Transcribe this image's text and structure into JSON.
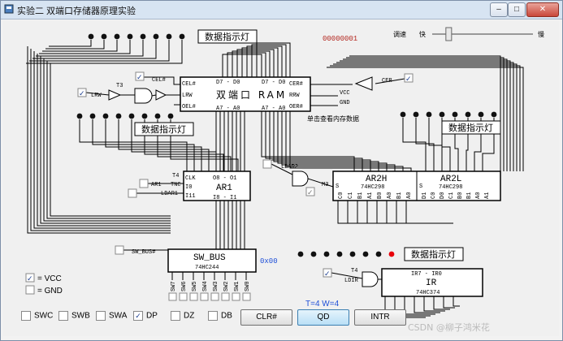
{
  "window": {
    "title": "实验二 双端口存储器原理实验",
    "controls": {
      "minimize": "–",
      "maximize": "□",
      "close": "✕"
    }
  },
  "ram": {
    "name": "双端口 RAM",
    "left_pins": [
      "CEL#",
      "LRW",
      "OEL#"
    ],
    "right_pins": [
      "CER#",
      "RRW",
      "OER#"
    ],
    "top_left": "D7 - D0",
    "top_right": "D7 - D0",
    "bottom_left": "A7 - A0",
    "bottom_right": "A7 - A0",
    "hint": "单击查看内存数据",
    "vcc": "VCC",
    "gnd": "GND"
  },
  "data_indicator_label": "数据指示灯",
  "memory_value": "00000001",
  "speed": {
    "label": "调速",
    "fast": "快",
    "slow": "慢",
    "level": 0.16
  },
  "gates": {
    "t3": "T3",
    "t4": "T4",
    "t2": "T2",
    "m3": "M3",
    "t4b": "T4"
  },
  "signals": {
    "cel": "CEL#",
    "lrw": "LRW",
    "cer": "CER",
    "ar1": "AR1",
    "ldar1": "LDAR1",
    "ldar2": "LDAR2",
    "ldir": "LDIR",
    "sw_bus": "SW_BUS#"
  },
  "ar1": {
    "name": "AR1",
    "pins_left": [
      "CLK",
      "I0",
      "I11"
    ],
    "top": "O8 - O1",
    "bottom": "I8 - I1",
    "tnc": "TNC"
  },
  "ar2": {
    "ar2h": "AR2H",
    "ar2l": "AR2L",
    "chip": "74HC298",
    "s": "S",
    "pins_h": [
      "C0",
      "C1",
      "B1",
      "A1",
      "B0",
      "A0",
      "B1",
      "A0"
    ],
    "pins_l": [
      "D1",
      "C0",
      "D0",
      "C1",
      "B0",
      "B1",
      "A0",
      "A1"
    ]
  },
  "sw_bus": {
    "name": "SW_BUS",
    "chip": "74HC244",
    "value": "0x00",
    "switches": [
      "SW7",
      "SW6",
      "SW5",
      "SW4",
      "SW3",
      "SW2",
      "SW1",
      "SW0"
    ]
  },
  "ir": {
    "name": "IR",
    "range": "IR7 - IR0",
    "chip": "74HC374"
  },
  "legend": {
    "vcc": "= VCC",
    "gnd": "= GND"
  },
  "mode_switches": [
    {
      "label": "SWC",
      "checked": false
    },
    {
      "label": "SWB",
      "checked": false
    },
    {
      "label": "SWA",
      "checked": false
    },
    {
      "label": "DP",
      "checked": true
    },
    {
      "label": "DZ",
      "checked": false
    },
    {
      "label": "DB",
      "checked": false
    }
  ],
  "timing": "T=4  W=4",
  "buttons": {
    "clr": "CLR#",
    "qd": "QD",
    "intr": "INTR"
  },
  "watermark": "CSDN @柳子鸿米花"
}
